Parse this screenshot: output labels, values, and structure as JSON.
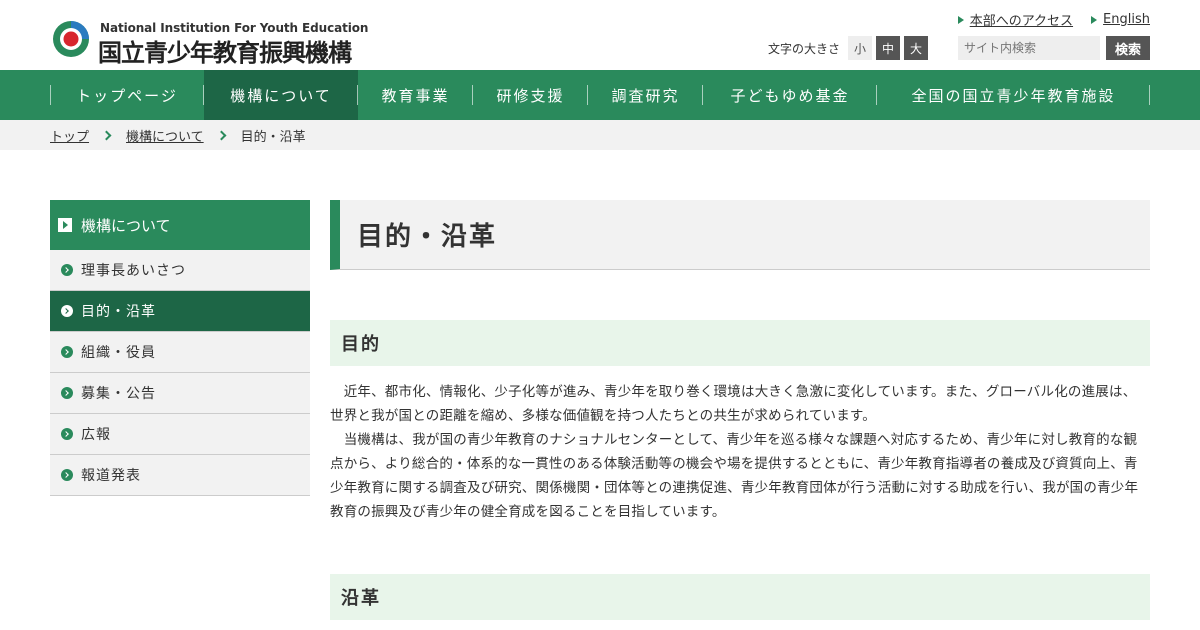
{
  "header": {
    "logo_en": "National Institution For Youth Education",
    "logo_ja": "国立青少年教育振興機構",
    "links": [
      {
        "label": "本部へのアクセス"
      },
      {
        "label": "English"
      }
    ],
    "font_size_label": "文字の大きさ",
    "font_sizes": {
      "small": "小",
      "mid": "中",
      "large": "大"
    },
    "search_placeholder": "サイト内検索",
    "search_button": "検索"
  },
  "nav": {
    "items": [
      {
        "label": "トップページ"
      },
      {
        "label": "機構について",
        "active": true
      },
      {
        "label": "教育事業"
      },
      {
        "label": "研修支援"
      },
      {
        "label": "調査研究"
      },
      {
        "label": "子どもゆめ基金"
      },
      {
        "label": "全国の国立青少年教育施設"
      }
    ]
  },
  "breadcrumb": {
    "items": [
      {
        "label": "トップ"
      },
      {
        "label": "機構について"
      },
      {
        "label": "目的・沿革"
      }
    ]
  },
  "sidebar": {
    "title": "機構について",
    "items": [
      {
        "label": "理事長あいさつ"
      },
      {
        "label": "目的・沿革",
        "active": true
      },
      {
        "label": "組織・役員"
      },
      {
        "label": "募集・公告"
      },
      {
        "label": "広報"
      },
      {
        "label": "報道発表"
      }
    ]
  },
  "main": {
    "title": "目的・沿革",
    "section1_heading": "目的",
    "para1": "近年、都市化、情報化、少子化等が進み、青少年を取り巻く環境は大きく急激に変化しています。また、グローバル化の進展は、世界と我が国との距離を縮め、多様な価値観を持つ人たちとの共生が求められています。",
    "para2": "当機構は、我が国の青少年教育のナショナルセンターとして、青少年を巡る様々な課題へ対応するため、青少年に対し教育的な観点から、より総合的・体系的な一貫性のある体験活動等の機会や場を提供するとともに、青少年教育指導者の養成及び資質向上、青少年教育に関する調査及び研究、関係機関・団体等との連携促進、青少年教育団体が行う活動に対する助成を行い、我が国の青少年教育の振興及び青少年の健全育成を図ることを目指しています。",
    "section2_heading": "沿革"
  },
  "colors": {
    "brand_green": "#2a8a5c",
    "dark_green": "#1d6646",
    "section_bg": "#e8f5ea"
  }
}
